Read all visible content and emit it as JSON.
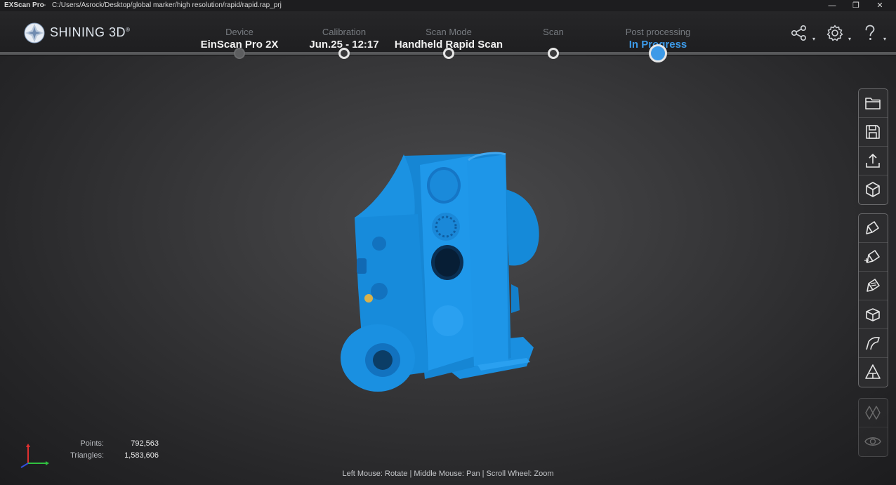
{
  "titlebar": {
    "app": "EXScan Pro",
    "separator": "-",
    "path": "C:/Users/Asrock/Desktop/global marker/high resolution/rapid/rapid.rap_prj",
    "minimize": "—",
    "restore": "❐",
    "close": "✕"
  },
  "brand": {
    "name": "SHINING 3D",
    "mark": "®"
  },
  "steps": [
    {
      "label": "Device",
      "value": "EinScan Pro 2X"
    },
    {
      "label": "Calibration",
      "value": "Jun.25 - 12:17"
    },
    {
      "label": "Scan Mode",
      "value": "Handheld Rapid Scan"
    },
    {
      "label": "Scan",
      "value": ""
    },
    {
      "label": "Post processing",
      "value": "In Progress"
    }
  ],
  "header_buttons": {
    "share": {
      "icon": "share-icon",
      "caret": "▾"
    },
    "settings": {
      "icon": "gear-icon",
      "caret": "▾"
    },
    "help": {
      "icon": "help-icon",
      "caret": "▾"
    }
  },
  "tool_groups": [
    [
      "folder-icon",
      "save-icon",
      "export-icon",
      "cube-icon"
    ],
    [
      "brush-icon",
      "brush-plus-icon",
      "brush-minus-icon",
      "box-select-icon",
      "curve-icon",
      "triangle-icon"
    ],
    [
      "mesh-icon",
      "eye-icon"
    ]
  ],
  "stats": {
    "points_label": "Points:",
    "points_value": "792,563",
    "triangles_label": "Triangles:",
    "triangles_value": "1,583,606"
  },
  "hint": "Left Mouse: Rotate | Middle Mouse: Pan | Scroll Wheel: Zoom",
  "colors": {
    "accent": "#3d9ae8",
    "model": "#1a8fe0",
    "background": "#3a3a3c"
  }
}
